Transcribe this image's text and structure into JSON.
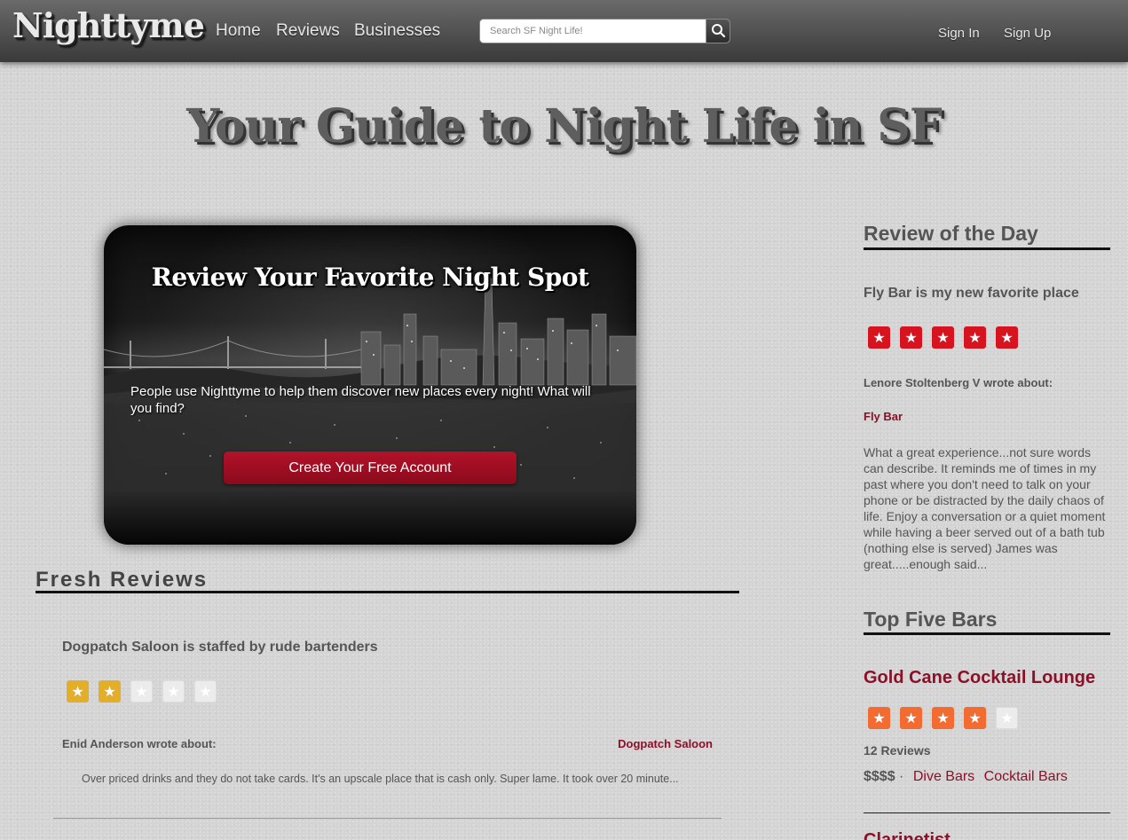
{
  "nav": {
    "logo": "Nighttyme",
    "links": [
      "Home",
      "Reviews",
      "Businesses"
    ],
    "search_placeholder": "Search SF Night Life!",
    "sign_in": "Sign In",
    "sign_up": "Sign Up"
  },
  "headline": "Your Guide to Night Life in SF",
  "hero": {
    "title": "Review Your Favorite Night Spot",
    "text": "People use Nighttyme to help them discover new places every night! What will you find?",
    "cta": "Create Your Free Account"
  },
  "fresh_reviews": {
    "heading": "Fresh Reviews",
    "items": [
      {
        "title": "Dogpatch Saloon is staffed by rude bartenders",
        "rating": 2,
        "max_rating": 5,
        "author": "Enid Anderson wrote about:",
        "business": "Dogpatch Saloon",
        "excerpt": "Over priced drinks and they do not take cards. It's an upscale place that is cash only. Super lame. It took over 20 minute..."
      }
    ]
  },
  "review_of_the_day": {
    "heading": "Review of the Day",
    "title": "Fly Bar is my new favorite place",
    "rating": 5,
    "author": "Lenore Stoltenberg V wrote about:",
    "business": "Fly Bar",
    "body": "What a great experience...not sure words can describe. It reminds me of times in my past where you don't need to talk on your phone or be distracted by the daily chaos of life. Enjoy a conversation or a quiet moment while having a beer served out of a bath tub (nothing else is served) James was great.....enough said..."
  },
  "top_five": {
    "heading": "Top Five Bars",
    "bars": [
      {
        "name": "Gold Cane Cocktail Lounge",
        "rating": 4,
        "max_rating": 5,
        "reviews": "12 Reviews",
        "price": "$$$$",
        "separator": "·",
        "categories": [
          "Dive Bars",
          "Cocktail Bars"
        ]
      }
    ],
    "next_partial": "Clarinetist..."
  },
  "colors": {
    "accent": "#8b1028",
    "cta": "#a30e22",
    "star_gold": "#e3ae2a",
    "star_red": "#d6141f",
    "star_orange": "#f26b30"
  }
}
